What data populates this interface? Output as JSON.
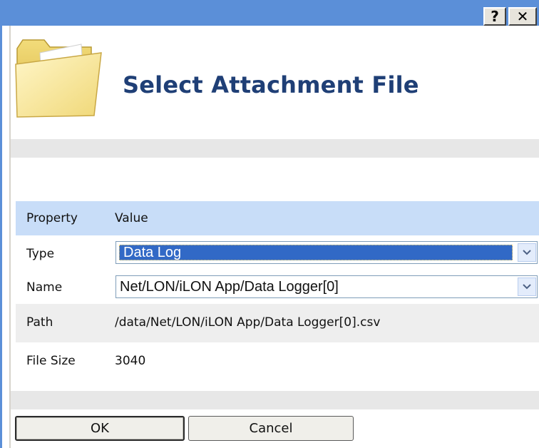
{
  "window": {
    "title": "",
    "help_label": "?",
    "close_label": "✕"
  },
  "dialog": {
    "heading": "Select Attachment File",
    "icon": "folder-icon"
  },
  "table": {
    "header": {
      "property": "Property",
      "value": "Value"
    },
    "rows": {
      "type": {
        "label": "Type",
        "value": "Data Log"
      },
      "name": {
        "label": "Name",
        "value": "Net/LON/iLON App/Data Logger[0]"
      },
      "path": {
        "label": "Path",
        "value": "/data/Net/LON/iLON App/Data Logger[0].csv"
      },
      "file_size": {
        "label": "File Size",
        "value": "3040"
      }
    }
  },
  "buttons": {
    "ok": "OK",
    "cancel": "Cancel"
  },
  "colors": {
    "titlebar": "#5b8fd8",
    "heading": "#1f3f76",
    "header_row": "#c8ddf8",
    "selection": "#3169c6"
  }
}
